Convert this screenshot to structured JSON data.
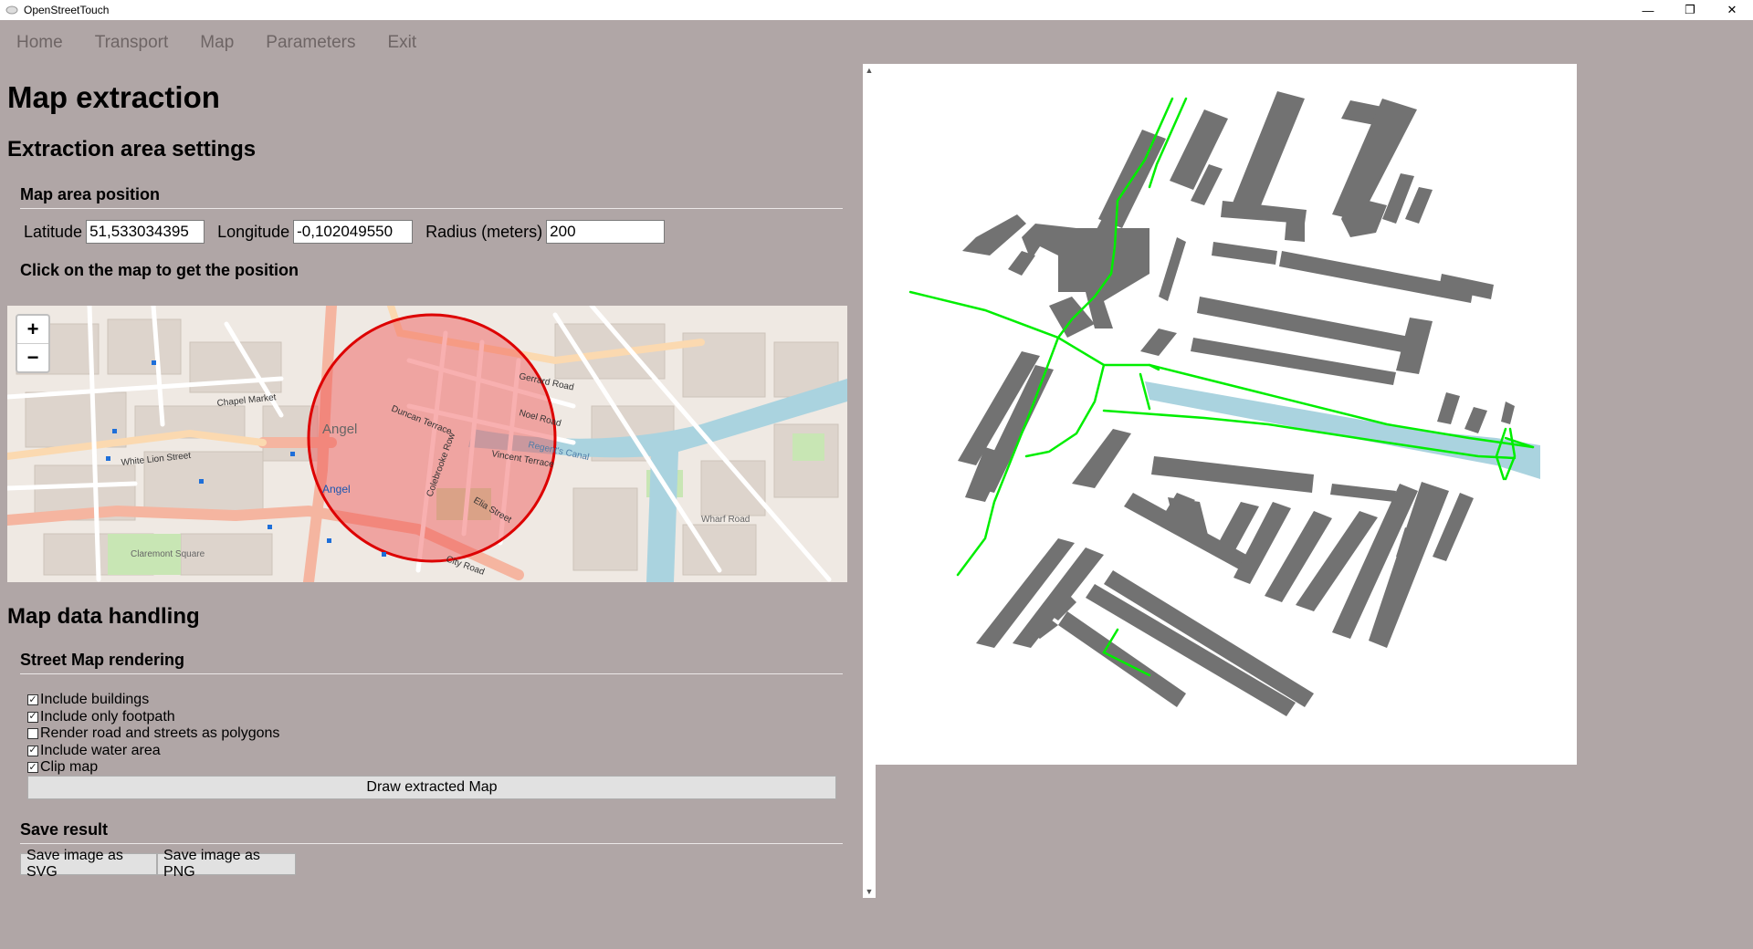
{
  "window": {
    "title": "OpenStreetTouch"
  },
  "menu": {
    "items": [
      "Home",
      "Transport",
      "Map",
      "Parameters",
      "Exit"
    ]
  },
  "page": {
    "title": "Map extraction"
  },
  "extraction": {
    "section_title": "Extraction area settings",
    "position_title": "Map area position",
    "latitude_label": "Latitude",
    "latitude_value": "51,533034395",
    "longitude_label": "Longitude",
    "longitude_value": "-0,102049550",
    "radius_label": "Radius (meters)",
    "radius_value": "200",
    "click_hint": "Click on the map to get the position"
  },
  "minimap": {
    "zoom_in": "+",
    "zoom_out": "−",
    "labels": {
      "angel": "Angel",
      "angel_station": "Angel",
      "regents_canal": "Regent's Canal",
      "duncan_terrace": "Duncan Terrace",
      "colebrooke_row": "Colebrooke Row",
      "noel_road": "Noel Road",
      "vincent_terrace": "Vincent Terrace",
      "gerrard_road": "Gerrard Road",
      "elia_street": "Elia Street",
      "chapel_market": "Chapel Market",
      "white_lion_street": "White Lion Street",
      "city_road": "City Road",
      "wharf_road": "Wharf Road",
      "claremont_square": "Claremont Square"
    }
  },
  "handling": {
    "section_title": "Map data handling",
    "rendering_title": "Street Map rendering",
    "checkboxes": [
      {
        "label": "Include buildings",
        "checked": true
      },
      {
        "label": "Include only footpath",
        "checked": true
      },
      {
        "label": "Render road and streets as polygons",
        "checked": false
      },
      {
        "label": "Include water area",
        "checked": true
      },
      {
        "label": "Clip map",
        "checked": true
      }
    ],
    "draw_button": "Draw extracted Map"
  },
  "save": {
    "section_title": "Save result",
    "svg_button": "Save image as SVG",
    "png_button": "Save image as PNG"
  },
  "colors": {
    "background": "#b0a6a6",
    "building": "#707070",
    "footpath": "#00ee00",
    "water": "#aad3df",
    "selection_circle": "#dd0000"
  },
  "icons": {
    "minimize": "minimize-icon",
    "restore": "restore-icon",
    "close": "close-icon"
  }
}
